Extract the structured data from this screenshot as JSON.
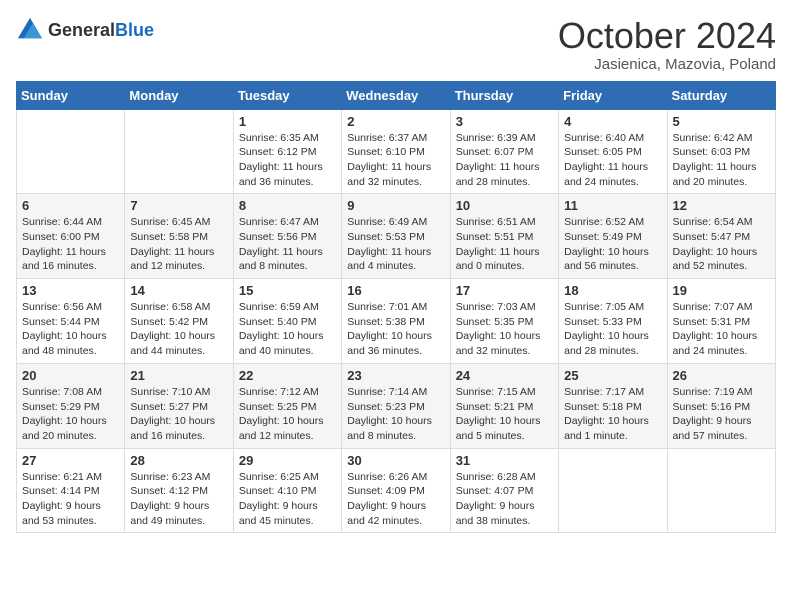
{
  "header": {
    "logo_general": "General",
    "logo_blue": "Blue",
    "month_title": "October 2024",
    "location": "Jasienica, Mazovia, Poland"
  },
  "weekdays": [
    "Sunday",
    "Monday",
    "Tuesday",
    "Wednesday",
    "Thursday",
    "Friday",
    "Saturday"
  ],
  "weeks": [
    [
      {
        "day": "",
        "info": ""
      },
      {
        "day": "",
        "info": ""
      },
      {
        "day": "1",
        "info": "Sunrise: 6:35 AM\nSunset: 6:12 PM\nDaylight: 11 hours and 36 minutes."
      },
      {
        "day": "2",
        "info": "Sunrise: 6:37 AM\nSunset: 6:10 PM\nDaylight: 11 hours and 32 minutes."
      },
      {
        "day": "3",
        "info": "Sunrise: 6:39 AM\nSunset: 6:07 PM\nDaylight: 11 hours and 28 minutes."
      },
      {
        "day": "4",
        "info": "Sunrise: 6:40 AM\nSunset: 6:05 PM\nDaylight: 11 hours and 24 minutes."
      },
      {
        "day": "5",
        "info": "Sunrise: 6:42 AM\nSunset: 6:03 PM\nDaylight: 11 hours and 20 minutes."
      }
    ],
    [
      {
        "day": "6",
        "info": "Sunrise: 6:44 AM\nSunset: 6:00 PM\nDaylight: 11 hours and 16 minutes."
      },
      {
        "day": "7",
        "info": "Sunrise: 6:45 AM\nSunset: 5:58 PM\nDaylight: 11 hours and 12 minutes."
      },
      {
        "day": "8",
        "info": "Sunrise: 6:47 AM\nSunset: 5:56 PM\nDaylight: 11 hours and 8 minutes."
      },
      {
        "day": "9",
        "info": "Sunrise: 6:49 AM\nSunset: 5:53 PM\nDaylight: 11 hours and 4 minutes."
      },
      {
        "day": "10",
        "info": "Sunrise: 6:51 AM\nSunset: 5:51 PM\nDaylight: 11 hours and 0 minutes."
      },
      {
        "day": "11",
        "info": "Sunrise: 6:52 AM\nSunset: 5:49 PM\nDaylight: 10 hours and 56 minutes."
      },
      {
        "day": "12",
        "info": "Sunrise: 6:54 AM\nSunset: 5:47 PM\nDaylight: 10 hours and 52 minutes."
      }
    ],
    [
      {
        "day": "13",
        "info": "Sunrise: 6:56 AM\nSunset: 5:44 PM\nDaylight: 10 hours and 48 minutes."
      },
      {
        "day": "14",
        "info": "Sunrise: 6:58 AM\nSunset: 5:42 PM\nDaylight: 10 hours and 44 minutes."
      },
      {
        "day": "15",
        "info": "Sunrise: 6:59 AM\nSunset: 5:40 PM\nDaylight: 10 hours and 40 minutes."
      },
      {
        "day": "16",
        "info": "Sunrise: 7:01 AM\nSunset: 5:38 PM\nDaylight: 10 hours and 36 minutes."
      },
      {
        "day": "17",
        "info": "Sunrise: 7:03 AM\nSunset: 5:35 PM\nDaylight: 10 hours and 32 minutes."
      },
      {
        "day": "18",
        "info": "Sunrise: 7:05 AM\nSunset: 5:33 PM\nDaylight: 10 hours and 28 minutes."
      },
      {
        "day": "19",
        "info": "Sunrise: 7:07 AM\nSunset: 5:31 PM\nDaylight: 10 hours and 24 minutes."
      }
    ],
    [
      {
        "day": "20",
        "info": "Sunrise: 7:08 AM\nSunset: 5:29 PM\nDaylight: 10 hours and 20 minutes."
      },
      {
        "day": "21",
        "info": "Sunrise: 7:10 AM\nSunset: 5:27 PM\nDaylight: 10 hours and 16 minutes."
      },
      {
        "day": "22",
        "info": "Sunrise: 7:12 AM\nSunset: 5:25 PM\nDaylight: 10 hours and 12 minutes."
      },
      {
        "day": "23",
        "info": "Sunrise: 7:14 AM\nSunset: 5:23 PM\nDaylight: 10 hours and 8 minutes."
      },
      {
        "day": "24",
        "info": "Sunrise: 7:15 AM\nSunset: 5:21 PM\nDaylight: 10 hours and 5 minutes."
      },
      {
        "day": "25",
        "info": "Sunrise: 7:17 AM\nSunset: 5:18 PM\nDaylight: 10 hours and 1 minute."
      },
      {
        "day": "26",
        "info": "Sunrise: 7:19 AM\nSunset: 5:16 PM\nDaylight: 9 hours and 57 minutes."
      }
    ],
    [
      {
        "day": "27",
        "info": "Sunrise: 6:21 AM\nSunset: 4:14 PM\nDaylight: 9 hours and 53 minutes."
      },
      {
        "day": "28",
        "info": "Sunrise: 6:23 AM\nSunset: 4:12 PM\nDaylight: 9 hours and 49 minutes."
      },
      {
        "day": "29",
        "info": "Sunrise: 6:25 AM\nSunset: 4:10 PM\nDaylight: 9 hours and 45 minutes."
      },
      {
        "day": "30",
        "info": "Sunrise: 6:26 AM\nSunset: 4:09 PM\nDaylight: 9 hours and 42 minutes."
      },
      {
        "day": "31",
        "info": "Sunrise: 6:28 AM\nSunset: 4:07 PM\nDaylight: 9 hours and 38 minutes."
      },
      {
        "day": "",
        "info": ""
      },
      {
        "day": "",
        "info": ""
      }
    ]
  ]
}
